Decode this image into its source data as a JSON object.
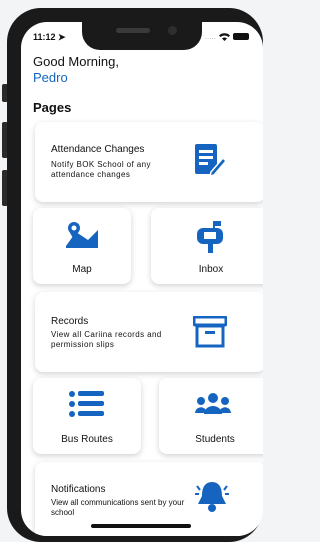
{
  "status_bar": {
    "time": "11:12",
    "dots": "....."
  },
  "greeting": "Good Morning,",
  "user_name": "Pedro",
  "section_title": "Pages",
  "cards": {
    "attendance": {
      "title": "Attendance Changes",
      "description": "Notify BOK School of any attendance changes",
      "icon": "edit-document-icon"
    },
    "map": {
      "label": "Map",
      "icon": "map-icon"
    },
    "inbox": {
      "label": "Inbox",
      "icon": "mailbox-icon"
    },
    "records": {
      "title": "Records",
      "description": "View all Cariina records and permission slips",
      "icon": "archive-icon"
    },
    "bus_routes": {
      "label": "Bus Routes",
      "icon": "list-icon"
    },
    "students": {
      "label": "Students",
      "icon": "users-icon"
    },
    "notifications": {
      "title": "Notifications",
      "description": "View all communications sent by your school",
      "icon": "bell-icon"
    }
  },
  "colors": {
    "accent": "#1565c0",
    "frame": "#1a1a1a"
  }
}
